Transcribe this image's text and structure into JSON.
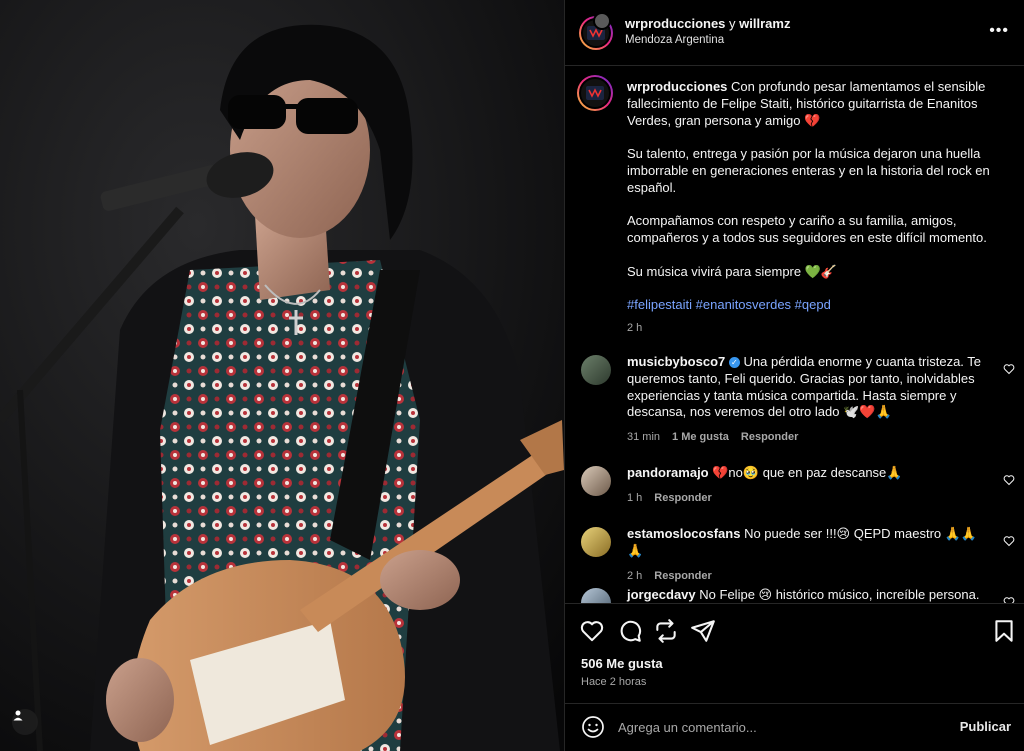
{
  "post": {
    "image_alt": "Guitarist with sunglasses and floral shirt singing into microphone while playing a guitar",
    "header": {
      "author": "wrproducciones",
      "connector": "y",
      "coauthor": "willramz",
      "location": "Mendoza Argentina",
      "more_label": "•••"
    },
    "caption": {
      "username": "wrproducciones",
      "p1": "Con profundo pesar lamentamos el sensible fallecimiento de Felipe Staiti, histórico guitarrista de Enanitos Verdes, gran persona y amigo 💔",
      "p2": "Su talento, entrega y pasión por la música dejaron una huella imborrable en generaciones enteras y en la historia del rock en español.",
      "p3": "Acompañamos con respeto y cariño a su familia, amigos, compañeros y a todos sus seguidores en este difícil momento.",
      "p4": "Su música vivirá para siempre 💚🎸",
      "hashtags": "#felipestaiti #enanitosverdes #qepd",
      "time": "2 h"
    },
    "comments": [
      {
        "username": "musicbybosco7",
        "verified_mark": "✓",
        "text": "Una pérdida enorme y cuanta tristeza. Te queremos tanto, Feli querido. Gracias por tanto, inolvidables experiencias y tanta música compartida. Hasta siempre y descansa, nos veremos del otro lado 🕊️❤️🙏",
        "time": "31 min",
        "likes": "1 Me gusta",
        "reply": "Responder"
      },
      {
        "username": "pandoramajo",
        "text": "💔no🥹 que en paz descanse🙏",
        "time": "1 h",
        "reply": "Responder"
      },
      {
        "username": "estamoslocosfans",
        "text": "No puede ser !!!😢 QEPD maestro 🙏🙏🙏",
        "time": "2 h",
        "reply": "Responder"
      },
      {
        "username": "jorgecdavy",
        "text": "No Felipe 😢 histórico músico, increíble persona.",
        "time": "",
        "reply": ""
      }
    ],
    "likes_count": "506 Me gusta",
    "posted_ago": "Hace 2 horas",
    "composer": {
      "placeholder": "Agrega un comentario...",
      "publish": "Publicar"
    }
  }
}
